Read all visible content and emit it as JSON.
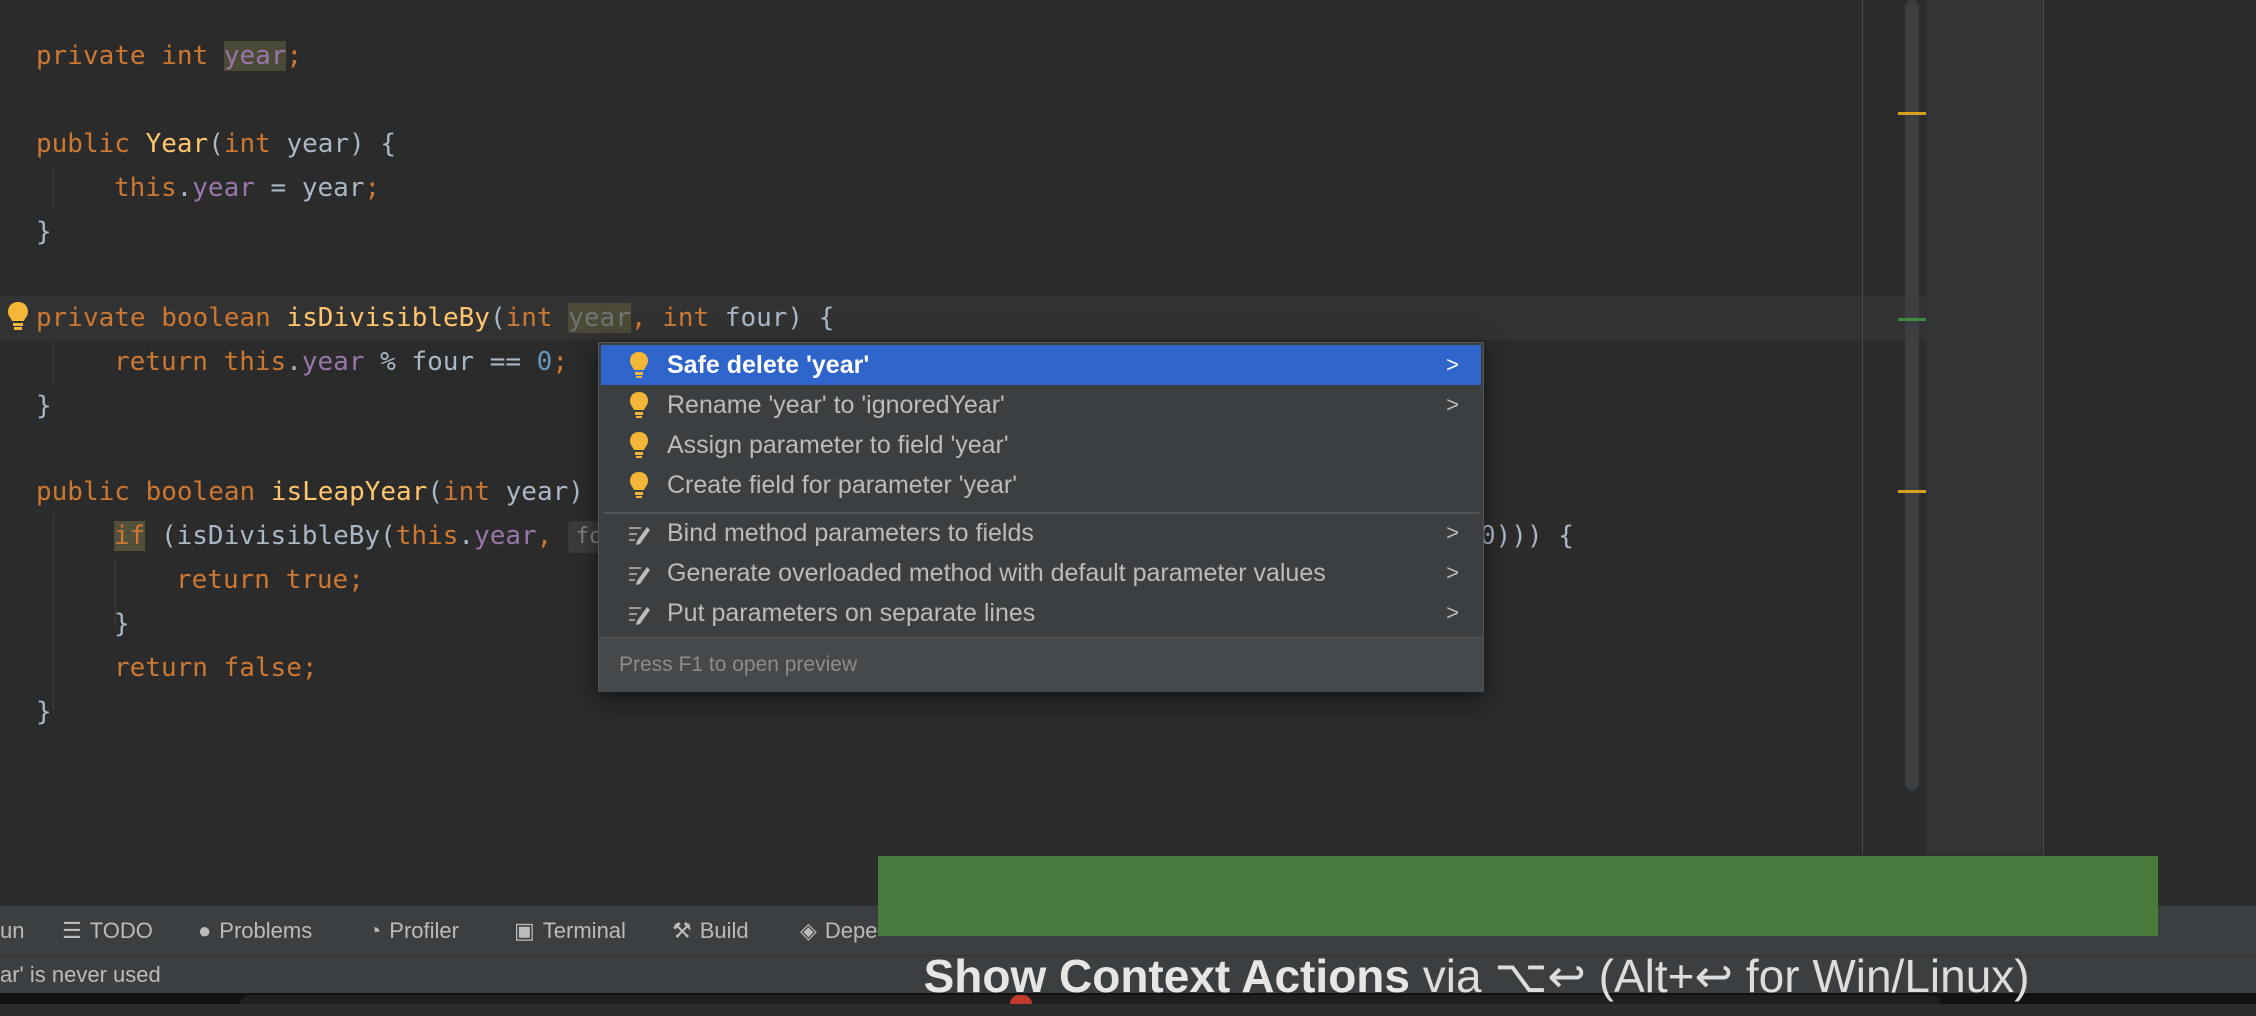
{
  "editor": {
    "lines": [
      {
        "tokens": [
          [
            "kw",
            "private "
          ],
          [
            "kw",
            "int "
          ],
          [
            "fld hl-var",
            "year"
          ],
          [
            "kw",
            ";"
          ]
        ]
      },
      {
        "tokens": [
          [
            "kw",
            "public "
          ],
          [
            "fn",
            "Year"
          ],
          [
            "",
            "("
          ],
          [
            "kw",
            "int "
          ],
          [
            "",
            "year) {"
          ]
        ]
      },
      {
        "tokens": [
          [
            "kw",
            "this"
          ],
          [
            "",
            "."
          ],
          [
            "fld",
            "year"
          ],
          [
            "",
            " = year"
          ],
          [
            "kw",
            ";"
          ]
        ]
      },
      {
        "tokens": [
          [
            "",
            "}"
          ]
        ]
      },
      {
        "tokens": [
          [
            "kw",
            "private "
          ],
          [
            "kw",
            "boolean "
          ],
          [
            "fn",
            "isDivisibleBy"
          ],
          [
            "",
            "("
          ],
          [
            "kw",
            "int "
          ],
          [
            "unused hl-var",
            "year"
          ],
          [
            "kw",
            ", "
          ],
          [
            "kw",
            "int "
          ],
          [
            "",
            "four) {"
          ]
        ]
      },
      {
        "tokens": [
          [
            "kw",
            "return "
          ],
          [
            "kw",
            "this"
          ],
          [
            "",
            "."
          ],
          [
            "fld",
            "year"
          ],
          [
            "",
            " % four == "
          ],
          [
            "num",
            "0"
          ],
          [
            "kw",
            ";"
          ]
        ]
      },
      {
        "tokens": [
          [
            "",
            "}"
          ]
        ]
      },
      {
        "tokens": [
          [
            "kw",
            "public "
          ],
          [
            "kw",
            "boolean "
          ],
          [
            "fn",
            "isLeapYear"
          ],
          [
            "",
            "("
          ],
          [
            "kw",
            "int "
          ],
          [
            "",
            "year)"
          ]
        ]
      },
      {
        "tokens": [
          [
            "kw hl-if",
            "if"
          ],
          [
            "",
            " (isDivisibleBy("
          ],
          [
            "kw",
            "this"
          ],
          [
            "",
            "."
          ],
          [
            "fld",
            "year"
          ],
          [
            "kw",
            ", "
          ],
          [
            "hint",
            "fo"
          ]
        ]
      },
      {
        "tokens": [
          [
            "kw",
            "return "
          ],
          [
            "kw",
            "true"
          ],
          [
            "kw",
            ";"
          ]
        ]
      },
      {
        "tokens": [
          [
            "",
            "}"
          ]
        ]
      },
      {
        "tokens": [
          [
            "kw",
            "return "
          ],
          [
            "kw",
            "false"
          ],
          [
            "kw",
            ";"
          ]
        ]
      },
      {
        "tokens": [
          [
            "",
            "}"
          ]
        ]
      }
    ],
    "overflow_tail": "0))) {",
    "intention_icon": "lightbulb-icon"
  },
  "context_menu": {
    "items": [
      {
        "label": "Safe delete 'year'",
        "icon": "lightbulb-icon",
        "submenu": true,
        "selected": true
      },
      {
        "label": "Rename 'year' to 'ignoredYear'",
        "icon": "lightbulb-icon",
        "submenu": true,
        "selected": false
      },
      {
        "label": "Assign parameter to field 'year'",
        "icon": "lightbulb-icon",
        "submenu": false,
        "selected": false
      },
      {
        "label": "Create field for parameter 'year'",
        "icon": "lightbulb-icon",
        "submenu": false,
        "selected": false
      },
      {
        "label": "Bind method parameters to fields",
        "icon": "pencil-icon",
        "submenu": true,
        "selected": false
      },
      {
        "label": "Generate overloaded method with default parameter values",
        "icon": "pencil-icon",
        "submenu": true,
        "selected": false
      },
      {
        "label": "Put parameters on separate lines",
        "icon": "pencil-icon",
        "submenu": true,
        "selected": false
      }
    ],
    "footer": "Press F1 to open preview",
    "arrow": ">"
  },
  "tool_windows": {
    "run": "un",
    "todo": "TODO",
    "problems": "Problems",
    "profiler": "Profiler",
    "terminal": "Terminal",
    "build": "Build",
    "dependencies": "Depe"
  },
  "status": {
    "message": "ar' is never used"
  },
  "banner": {
    "action": "Show Context Actions",
    "rest": " via ⌥↩ (Alt+↩ for Win/Linux)"
  },
  "colors": {
    "selection": "#2f65ca",
    "bulb": "#f4b636",
    "banner": "#4a803c"
  }
}
